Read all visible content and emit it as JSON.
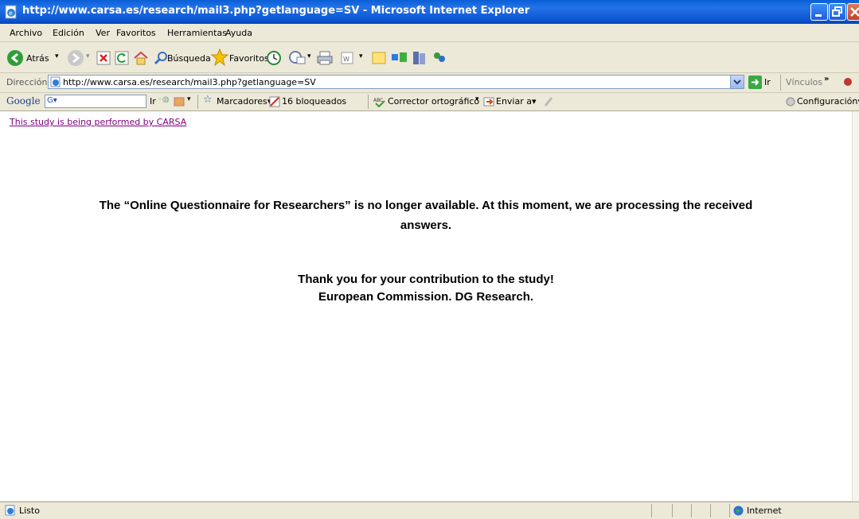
{
  "window": {
    "title": "http://www.carsa.es/research/mail3.php?getlanguage=SV - Microsoft Internet Explorer"
  },
  "menu": [
    "Archivo",
    "Edición",
    "Ver",
    "Favoritos",
    "Herramientas",
    "Ayuda"
  ],
  "toolbar": {
    "back_label": "Atrás",
    "search_label": "Búsqueda",
    "favorites_label": "Favoritos"
  },
  "address": {
    "label": "Dirección",
    "url": "http://www.carsa.es/research/mail3.php?getlanguage=SV",
    "go_label": "Ir",
    "links_label": "Vínculos"
  },
  "google_bar": {
    "logo": "Google",
    "go_label": "Ir",
    "bookmarks_label": "Marcadores",
    "blocked_label": "16 bloqueados",
    "spellcheck_label": "Corrector ortográfico",
    "send_label": "Enviar a",
    "settings_label": "Configuración"
  },
  "page": {
    "link": "This study is being performed by CARSA",
    "message_line1": "The “Online Questionnaire for Researchers” is no longer available. At this moment, we are processing the received",
    "message_line2": "answers.",
    "thanks_line1": "Thank you for your contribution to the study!",
    "thanks_line2": "European Commission. DG Research."
  },
  "status": {
    "text": "Listo",
    "zone": "Internet"
  },
  "colors": {
    "titlebar": "#0a5fd6",
    "visited_link": "#800080",
    "chrome": "#ece9d8"
  }
}
